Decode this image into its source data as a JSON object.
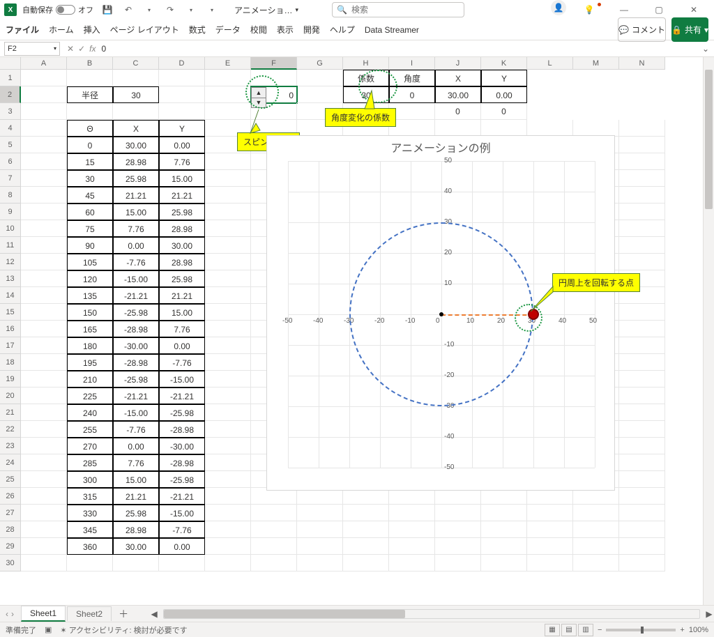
{
  "titlebar": {
    "app_icon": "X",
    "autosave_label": "自動保存",
    "autosave_state": "オフ",
    "filename": "アニメーショ…",
    "search_placeholder": "検索"
  },
  "menubar": {
    "items": [
      "ファイル",
      "ホーム",
      "挿入",
      "ページ レイアウト",
      "数式",
      "データ",
      "校閲",
      "表示",
      "開発",
      "ヘルプ",
      "Data Streamer"
    ],
    "comments": "コメント",
    "share": "共有"
  },
  "fxbar": {
    "name_box": "F2",
    "formula": "0"
  },
  "columns": [
    "A",
    "B",
    "C",
    "D",
    "E",
    "F",
    "G",
    "H",
    "I",
    "J",
    "K",
    "L",
    "M",
    "N"
  ],
  "radius_label": "半径",
  "radius_value": "30",
  "spin_value": "0",
  "header2": {
    "keisu": "係数",
    "kakudo": "角度",
    "x": "X",
    "y": "Y"
  },
  "row2": {
    "keisu": "30",
    "kakudo": "0",
    "x": "30.00",
    "y": "0.00"
  },
  "row3": {
    "x": "0",
    "y": "0"
  },
  "tbl_header": {
    "theta": "Θ",
    "x": "X",
    "y": "Y"
  },
  "table": [
    {
      "t": "0",
      "x": "30.00",
      "y": "0.00"
    },
    {
      "t": "15",
      "x": "28.98",
      "y": "7.76"
    },
    {
      "t": "30",
      "x": "25.98",
      "y": "15.00"
    },
    {
      "t": "45",
      "x": "21.21",
      "y": "21.21"
    },
    {
      "t": "60",
      "x": "15.00",
      "y": "25.98"
    },
    {
      "t": "75",
      "x": "7.76",
      "y": "28.98"
    },
    {
      "t": "90",
      "x": "0.00",
      "y": "30.00"
    },
    {
      "t": "105",
      "x": "-7.76",
      "y": "28.98"
    },
    {
      "t": "120",
      "x": "-15.00",
      "y": "25.98"
    },
    {
      "t": "135",
      "x": "-21.21",
      "y": "21.21"
    },
    {
      "t": "150",
      "x": "-25.98",
      "y": "15.00"
    },
    {
      "t": "165",
      "x": "-28.98",
      "y": "7.76"
    },
    {
      "t": "180",
      "x": "-30.00",
      "y": "0.00"
    },
    {
      "t": "195",
      "x": "-28.98",
      "y": "-7.76"
    },
    {
      "t": "210",
      "x": "-25.98",
      "y": "-15.00"
    },
    {
      "t": "225",
      "x": "-21.21",
      "y": "-21.21"
    },
    {
      "t": "240",
      "x": "-15.00",
      "y": "-25.98"
    },
    {
      "t": "255",
      "x": "-7.76",
      "y": "-28.98"
    },
    {
      "t": "270",
      "x": "0.00",
      "y": "-30.00"
    },
    {
      "t": "285",
      "x": "7.76",
      "y": "-28.98"
    },
    {
      "t": "300",
      "x": "15.00",
      "y": "-25.98"
    },
    {
      "t": "315",
      "x": "21.21",
      "y": "-21.21"
    },
    {
      "t": "330",
      "x": "25.98",
      "y": "-15.00"
    },
    {
      "t": "345",
      "x": "28.98",
      "y": "-7.76"
    },
    {
      "t": "360",
      "x": "30.00",
      "y": "0.00"
    }
  ],
  "callouts": {
    "spin": "スピンボタン",
    "keisu": "角度変化の係数",
    "point": "円周上を回転する点"
  },
  "chart_data": {
    "type": "scatter",
    "title": "アニメーションの例",
    "xlabel": "",
    "ylabel": "",
    "xlim": [
      -50,
      50
    ],
    "ylim": [
      -50,
      50
    ],
    "x_ticks": [
      -50,
      -40,
      -30,
      -20,
      -10,
      0,
      10,
      20,
      30,
      40,
      50
    ],
    "y_ticks": [
      -50,
      -40,
      -30,
      -20,
      -10,
      0,
      10,
      20,
      30,
      40,
      50
    ],
    "series": [
      {
        "name": "circle_r30",
        "type": "line",
        "dashed": true,
        "color": "#4472c4",
        "x": [
          30.0,
          28.98,
          25.98,
          21.21,
          15.0,
          7.76,
          0.0,
          -7.76,
          -15.0,
          -21.21,
          -25.98,
          -28.98,
          -30.0,
          -28.98,
          -25.98,
          -21.21,
          -15.0,
          -7.76,
          0.0,
          7.76,
          15.0,
          21.21,
          25.98,
          28.98,
          30.0
        ],
        "y": [
          0.0,
          7.76,
          15.0,
          21.21,
          25.98,
          28.98,
          30.0,
          28.98,
          25.98,
          21.21,
          15.0,
          7.76,
          0.0,
          -7.76,
          -15.0,
          -21.21,
          -25.98,
          -28.98,
          -30.0,
          -28.98,
          -25.98,
          -21.21,
          -15.0,
          -7.76,
          0.0
        ]
      },
      {
        "name": "radius_line",
        "type": "line",
        "dashed": true,
        "color": "#ed7d31",
        "x": [
          0,
          30
        ],
        "y": [
          0,
          0
        ]
      },
      {
        "name": "origin",
        "type": "point",
        "color": "#000000",
        "x": [
          0
        ],
        "y": [
          0
        ]
      },
      {
        "name": "moving_point",
        "type": "point",
        "color": "#c00000",
        "size": 16,
        "x": [
          30
        ],
        "y": [
          0
        ]
      }
    ]
  },
  "sheets": {
    "active": "Sheet1",
    "tabs": [
      "Sheet1",
      "Sheet2"
    ]
  },
  "statusbar": {
    "ready": "準備完了",
    "accessibility": "アクセシビリティ: 検討が必要です",
    "zoom": "100%"
  }
}
